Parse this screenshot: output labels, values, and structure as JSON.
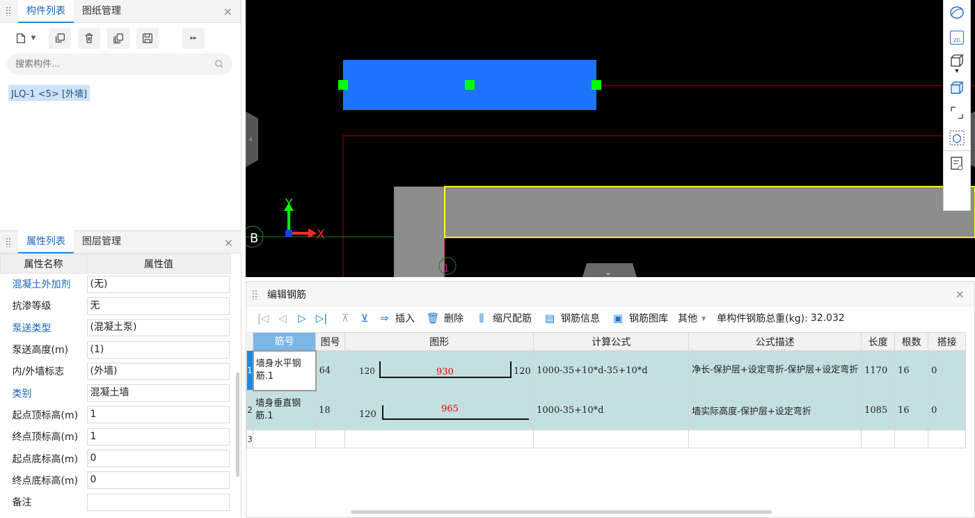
{
  "component_panel": {
    "tabs": [
      {
        "label": "构件列表",
        "active": true
      },
      {
        "label": "图纸管理",
        "active": false
      }
    ],
    "close": "×",
    "toolbar_icons": [
      "new-icon",
      "copy-icon",
      "delete-icon",
      "layer-copy-icon",
      "save-icon",
      "more-icon"
    ],
    "search_placeholder": "搜索构件...",
    "item": "JLQ-1 <5> [外墙]"
  },
  "property_panel": {
    "tabs": [
      {
        "label": "属性列表",
        "active": true
      },
      {
        "label": "图层管理",
        "active": false
      }
    ],
    "close": "×",
    "col_name": "属性名称",
    "col_value": "属性值",
    "rows": [
      {
        "name": "混凝土外加剂",
        "value": "(无)",
        "blue": true
      },
      {
        "name": "抗渗等级",
        "value": "无",
        "blue": false
      },
      {
        "name": "泵送类型",
        "value": "(混凝土泵)",
        "blue": true
      },
      {
        "name": "泵送高度(m)",
        "value": "(1)",
        "blue": false
      },
      {
        "name": "内/外墙标志",
        "value": "(外墙)",
        "blue": false
      },
      {
        "name": "类别",
        "value": "混凝土墙",
        "blue": true
      },
      {
        "name": "起点顶标高(m)",
        "value": "1",
        "blue": false
      },
      {
        "name": "终点顶标高(m)",
        "value": "1",
        "blue": false
      },
      {
        "name": "起点底标高(m)",
        "value": "0",
        "blue": false
      },
      {
        "name": "终点底标高(m)",
        "value": "0",
        "blue": false
      },
      {
        "name": "备注",
        "value": "",
        "blue": false
      }
    ]
  },
  "viewport": {
    "axis_y": "Y",
    "axis_x": "X",
    "grid_label": "B",
    "grid_label_partial": "1",
    "colors": {
      "background": "#000000",
      "wall": "#1e73ff",
      "grip": "#00ff00",
      "gray_wall": "#8c8c8c",
      "highlight": "#ffff00",
      "redline": "#b00000"
    }
  },
  "view_tools": [
    "orbit-icon",
    "2d-view-icon",
    "3d-box-icon",
    "3d-solid-icon",
    "section-box-icon",
    "view-cube-icon",
    "view-list-icon"
  ],
  "view_tool_2d_label": "2D",
  "rebar_editor": {
    "title": "编辑钢筋",
    "close": "×",
    "toolbar": {
      "insert": "插入",
      "delete": "删除",
      "scale": "缩尺配筋",
      "info": "钢筋信息",
      "library": "钢筋图库",
      "other": "其他",
      "total_label": "单构件钢筋总重(kg):",
      "total_value": "32.032"
    },
    "columns": [
      "筋号",
      "图号",
      "图形",
      "计算公式",
      "公式描述",
      "长度",
      "根数",
      "搭接"
    ],
    "rows": [
      {
        "idx": "1",
        "name": "墙身水平钢筋.1",
        "fig_no": "64",
        "left": "120",
        "mid": "930",
        "right": "120",
        "formula": "1000-35+10*d-35+10*d",
        "desc": "净长-保护层+设定弯折-保护层+设定弯折",
        "length": "1170",
        "count": "16",
        "lap": "0"
      },
      {
        "idx": "2",
        "name": "墙身垂直钢筋.1",
        "fig_no": "18",
        "left": "120",
        "mid": "965",
        "right": "",
        "formula": "1000-35+10*d",
        "desc": "墙实际高度-保护层+设定弯折",
        "length": "1085",
        "count": "16",
        "lap": "0"
      },
      {
        "idx": "3",
        "name": "",
        "fig_no": "",
        "left": "",
        "mid": "",
        "right": "",
        "formula": "",
        "desc": "",
        "length": "",
        "count": "",
        "lap": ""
      }
    ]
  }
}
